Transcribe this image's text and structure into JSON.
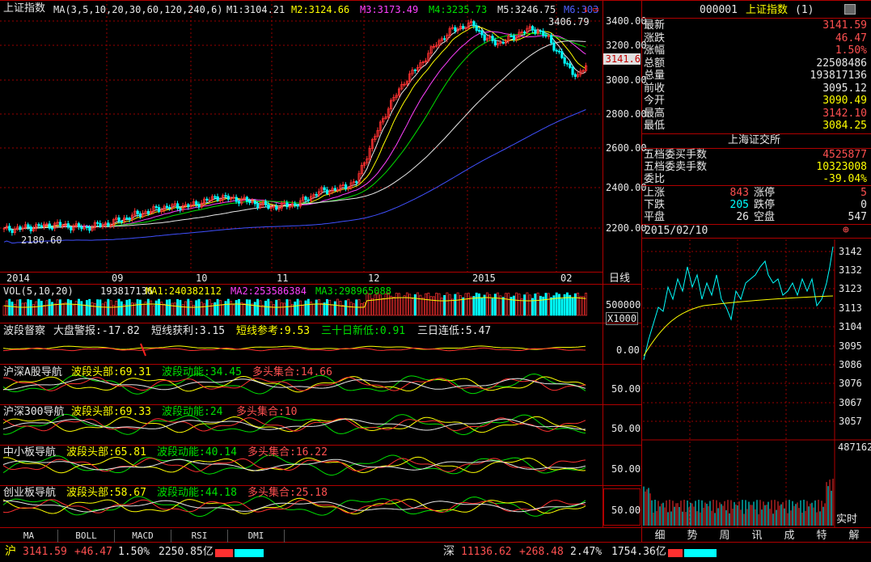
{
  "main": {
    "title": "上证指数",
    "ma_label": "MA(3,5,10,20,30,60,120,240,6)",
    "m1": "M1:3104.21",
    "m2": "M2:3124.66",
    "m3": "M3:3173.49",
    "m4": "M4:3235.73",
    "m5": "M5:3246.75",
    "m6": "M6:303",
    "high_label": "3406.79",
    "low_label": "2180.60",
    "last_price_tag": "3141.6",
    "y_axis": [
      "3400.00",
      "3200.00",
      "3000.00",
      "2800.00",
      "2600.00",
      "2400.00",
      "2200.00"
    ],
    "x_axis": [
      "2014",
      "09",
      "10",
      "11",
      "12",
      "2015",
      "02"
    ],
    "period": "日线"
  },
  "vol": {
    "label": "VOL(5,10,20)",
    "value": "193817136",
    "ma1": "MA1:240382112",
    "ma2": "MA2:253586384",
    "ma3": "MA3:298965088",
    "axis": "500000",
    "unit": "X1000"
  },
  "ind1": {
    "name": "波段督察",
    "a": "大盘警报:-17.82",
    "b": "短线获利:3.15",
    "c": "短线参考:9.53",
    "d": "三十日新低:0.91",
    "e": "三日连低:5.47",
    "axis": "0.00"
  },
  "ind2": {
    "name": "沪深A股导航",
    "a": "波段头部:69.31",
    "b": "波段动能:34.45",
    "c": "多头集合:14.66",
    "axis": "50.00"
  },
  "ind3": {
    "name": "沪深300导航",
    "a": "波段头部:69.33",
    "b": "波段动能:24",
    "c": "多头集合:10",
    "axis": "50.00"
  },
  "ind4": {
    "name": "中小板导航",
    "a": "波段头部:65.81",
    "b": "波段动能:40.14",
    "c": "多头集合:16.22",
    "axis": "50.00"
  },
  "ind5": {
    "name": "创业板导航",
    "a": "波段头部:58.67",
    "b": "波段动能:44.18",
    "c": "多头集合:25.18",
    "axis": "50.00"
  },
  "tabs": [
    "MA",
    "BOLL",
    "MACD",
    "RSI",
    "DMI"
  ],
  "quote": {
    "code": "000001",
    "name": "上证指数",
    "count": "(1)",
    "rows": [
      {
        "l": "最新",
        "v": "3141.59",
        "c": "red"
      },
      {
        "l": "涨跌",
        "v": "46.47",
        "c": "red"
      },
      {
        "l": "涨幅",
        "v": "1.50%",
        "c": "red"
      },
      {
        "l": "总额",
        "v": "22508486",
        "c": "wht"
      },
      {
        "l": "总量",
        "v": "193817136",
        "c": "wht"
      },
      {
        "l": "前收",
        "v": "3095.12",
        "c": "wht"
      },
      {
        "l": "今开",
        "v": "3090.49",
        "c": "yel"
      },
      {
        "l": "最高",
        "v": "3142.10",
        "c": "red"
      },
      {
        "l": "最低",
        "v": "3084.25",
        "c": "yel"
      }
    ],
    "exchange": "上海证交所",
    "buy_label": "五档委买手数",
    "buy": "4525877",
    "sell_label": "五档委卖手数",
    "sell": "10323008",
    "ratio_label": "委比",
    "ratio": "-39.04%",
    "up_label": "上涨",
    "up": "843",
    "zt_label": "涨停",
    "zt": "5",
    "down_label": "下跌",
    "down": "205",
    "dt_label": "跌停",
    "dt": "0",
    "flat_label": "平盘",
    "flat": "26",
    "kp_label": "空盘",
    "kp": "547"
  },
  "intraday": {
    "date": "2015/02/10",
    "y_axis": [
      "3142",
      "3132",
      "3123",
      "3113",
      "3104",
      "3095",
      "3086",
      "3076",
      "3067",
      "3057"
    ],
    "vol_max": "487162",
    "mode": "实时"
  },
  "right_tabs": [
    "细",
    "势",
    "周",
    "讯",
    "成",
    "特",
    "解"
  ],
  "status": {
    "sh_label": "沪",
    "sh_price": "3141.59",
    "sh_chg": "+46.47",
    "sh_pct": "1.50%",
    "sh_amt": "2250.85亿",
    "sz_label": "深",
    "sz_price": "11136.62",
    "sz_chg": "+268.48",
    "sz_pct": "2.47%",
    "sz_amt": "1754.36亿"
  },
  "colors": {
    "grid": "#b00000",
    "up": "#ff3030",
    "down": "#00ffff",
    "bg": "#000000"
  }
}
